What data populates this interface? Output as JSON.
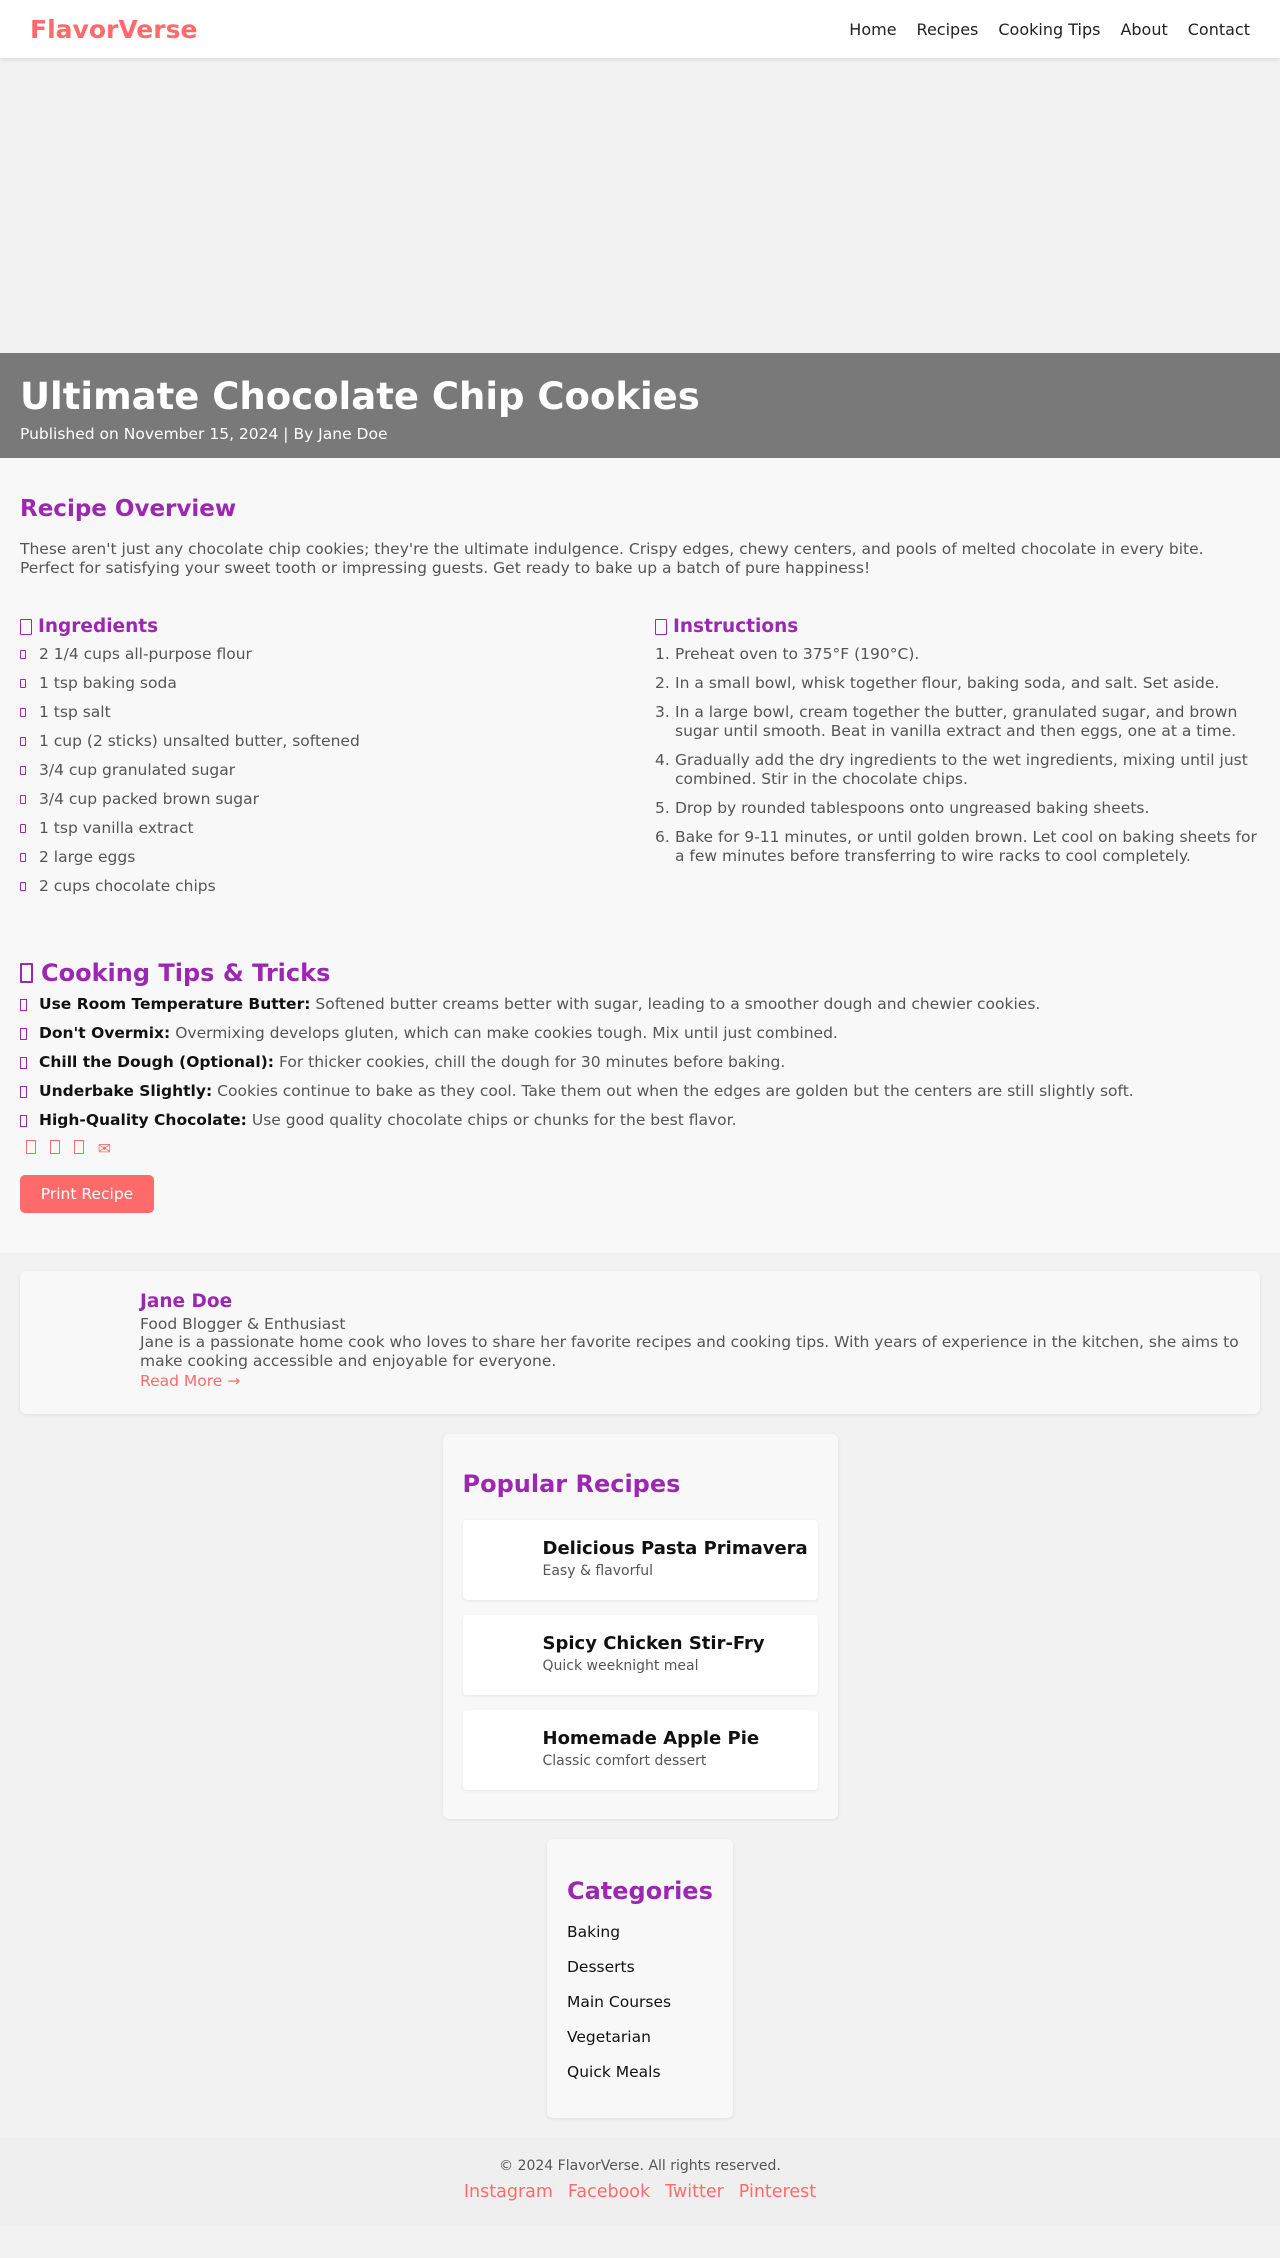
{
  "header": {
    "logo": "FlavorVerse",
    "nav": [
      "Home",
      "Recipes",
      "Cooking Tips",
      "About",
      "Contact"
    ]
  },
  "hero": {
    "title": "Ultimate Chocolate Chip Cookies",
    "meta": "Published on November 15, 2024 | By Jane Doe"
  },
  "overview": {
    "title": "Recipe Overview",
    "text": "These aren't just any chocolate chip cookies; they're the ultimate indulgence. Crispy edges, chewy centers, and pools of melted chocolate in every bite. Perfect for satisfying your sweet tooth or impressing guests. Get ready to bake up a batch of pure happiness!"
  },
  "ingredients": {
    "title": "Ingredients",
    "items": [
      "2 1/4 cups all-purpose flour",
      "1 tsp baking soda",
      "1 tsp salt",
      "1 cup (2 sticks) unsalted butter, softened",
      "3/4 cup granulated sugar",
      "3/4 cup packed brown sugar",
      "1 tsp vanilla extract",
      "2 large eggs",
      "2 cups chocolate chips"
    ]
  },
  "instructions": {
    "title": "Instructions",
    "steps": [
      {
        "num": "1.",
        "text": "Preheat oven to 375°F (190°C)."
      },
      {
        "num": "2.",
        "text": "In a small bowl, whisk together flour, baking soda, and salt. Set aside."
      },
      {
        "num": "3.",
        "text": "In a large bowl, cream together the butter, granulated sugar, and brown sugar until smooth. Beat in vanilla extract and then eggs, one at a time."
      },
      {
        "num": "4.",
        "text": "Gradually add the dry ingredients to the wet ingredients, mixing until just combined. Stir in the chocolate chips."
      },
      {
        "num": "5.",
        "text": "Drop by rounded tablespoons onto ungreased baking sheets."
      },
      {
        "num": "6.",
        "text": "Bake for 9-11 minutes, or until golden brown. Let cool on baking sheets for a few minutes before transferring to wire racks to cool completely."
      }
    ]
  },
  "tips": {
    "title": "Cooking Tips & Tricks",
    "items": [
      {
        "label": "Use Room Temperature Butter:",
        "text": "Softened butter creams better with sugar, leading to a smoother dough and chewier cookies."
      },
      {
        "label": "Don't Overmix:",
        "text": "Overmixing develops gluten, which can make cookies tough. Mix until just combined."
      },
      {
        "label": "Chill the Dough (Optional):",
        "text": "For thicker cookies, chill the dough for 30 minutes before baking."
      },
      {
        "label": "Underbake Slightly:",
        "text": "Cookies continue to bake as they cool. Take them out when the edges are golden but the centers are still slightly soft."
      },
      {
        "label": "High-Quality Chocolate:",
        "text": "Use good quality chocolate chips or chunks for the best flavor."
      }
    ]
  },
  "share": {
    "icons": [
      "facebook-icon",
      "twitter-icon",
      "pinterest-icon",
      "email-icon"
    ],
    "email_glyph": "✉"
  },
  "print_button": "Print Recipe",
  "author": {
    "name": "Jane Doe",
    "role": "Food Blogger & Enthusiast",
    "bio": "Jane is a passionate home cook who loves to share her favorite recipes and cooking tips. With years of experience in the kitchen, she aims to make cooking accessible and enjoyable for everyone.",
    "read_more": "Read More →"
  },
  "popular": {
    "title": "Popular Recipes",
    "items": [
      {
        "name": "Delicious Pasta Primavera",
        "desc": "Easy & flavorful"
      },
      {
        "name": "Spicy Chicken Stir-Fry",
        "desc": "Quick weeknight meal"
      },
      {
        "name": "Homemade Apple Pie",
        "desc": "Classic comfort dessert"
      }
    ]
  },
  "categories": {
    "title": "Categories",
    "items": [
      "Baking",
      "Desserts",
      "Main Courses",
      "Vegetarian",
      "Quick Meals"
    ]
  },
  "footer": {
    "copyright": "© 2024 FlavorVerse. All rights reserved.",
    "social": [
      "Instagram",
      "Facebook",
      "Twitter",
      "Pinterest"
    ]
  },
  "colors": {
    "brand": "#ff6b6b",
    "heading": "#9c27b0",
    "hero_band": "#797979"
  }
}
